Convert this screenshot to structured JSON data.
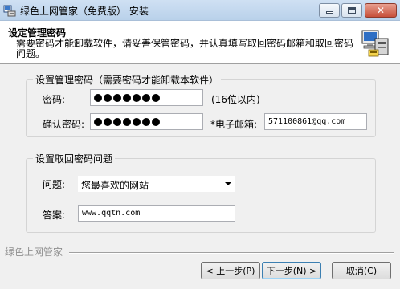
{
  "window": {
    "title": "绿色上网管家（免费版） 安装",
    "close_glyph": "✕"
  },
  "header": {
    "title": "设定管理密码",
    "description": "需要密码才能卸载软件，请妥善保管密码，并认真填写取回密码邮箱和取回密码问题。"
  },
  "password_group": {
    "legend": "设置管理密码（需要密码才能卸载本软件）",
    "password_label": "密码:",
    "password_hint": "(16位以内)",
    "confirm_label": "确认密码:",
    "email_label": "*电子邮箱:",
    "email_value": "571100861@qq.com",
    "password_dot_count": 7
  },
  "recovery_group": {
    "legend": "设置取回密码问题",
    "question_label": "问题:",
    "question_value": "您最喜欢的网站",
    "answer_label": "答案:",
    "answer_value": "www.qqtn.com"
  },
  "footer": {
    "brand": "绿色上网管家",
    "back_label": "< 上一步(P)",
    "next_label": "下一步(N) >",
    "cancel_label": "取消(C)"
  },
  "icons": {
    "app": "installer-app-icon",
    "header_logo": "installer-computer-icon"
  }
}
